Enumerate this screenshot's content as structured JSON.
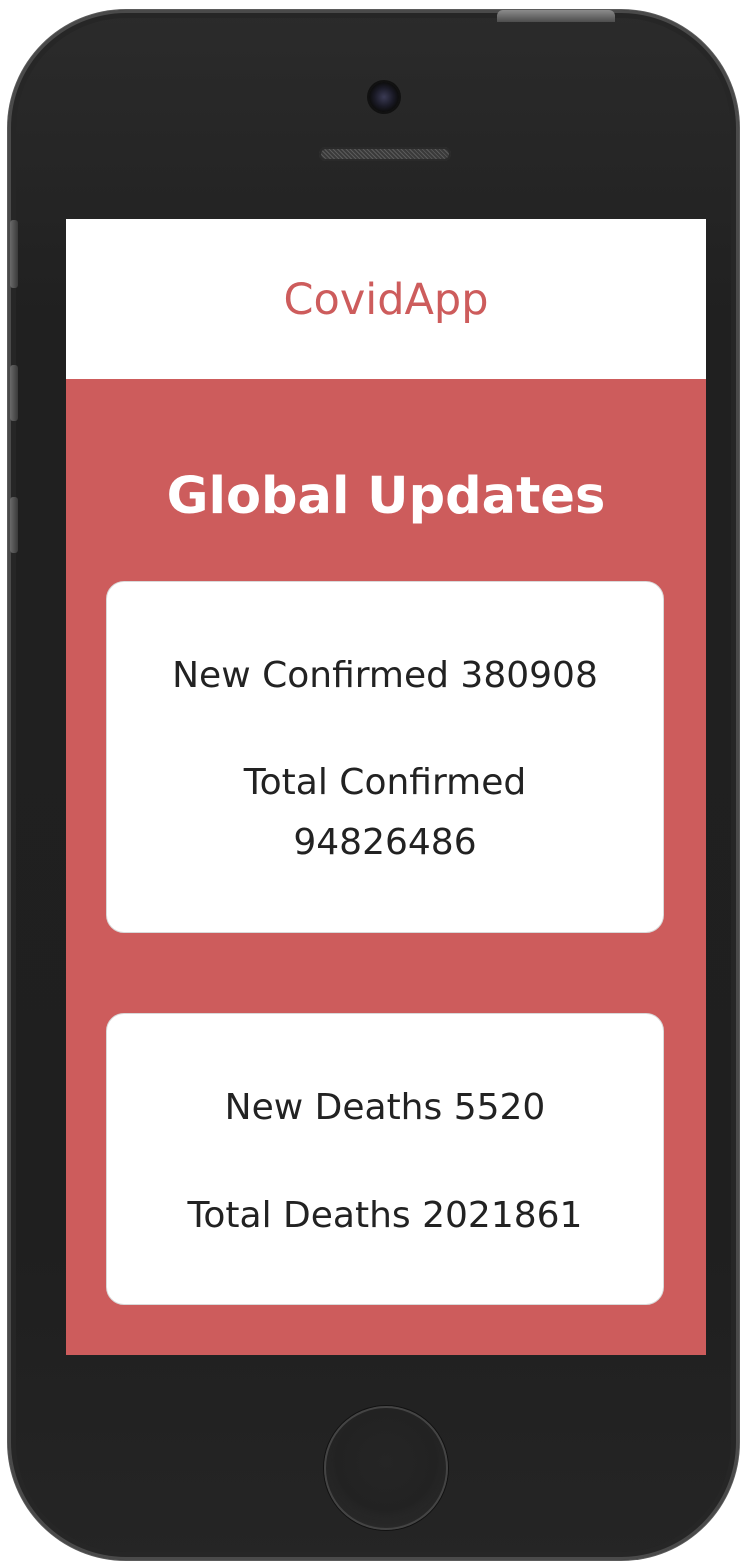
{
  "app": {
    "brand": "CovidApp"
  },
  "main": {
    "heading": "Global Updates",
    "cards": [
      {
        "lines": [
          "New Confirmed 380908",
          "Total Confirmed 94826486"
        ]
      },
      {
        "lines": [
          "New Deaths 5520",
          "Total Deaths 2021861"
        ]
      }
    ]
  },
  "colors": {
    "accent": "#cd5c5c",
    "card_background": "#ffffff",
    "text_dark": "#222222",
    "phone_body": "#202020"
  },
  "icons": {
    "camera": "camera-icon",
    "speaker": "speaker-icon",
    "home_button": "home-button-icon"
  }
}
